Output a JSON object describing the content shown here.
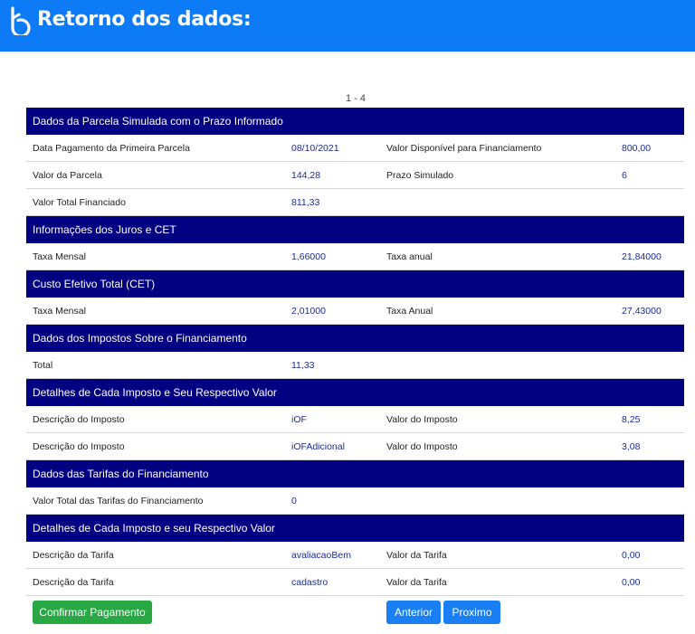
{
  "header": {
    "title": "Retorno dos dados:",
    "background_color": "#0d7bf5",
    "logo_icon": "brand-b-logo-icon"
  },
  "pager": {
    "text": "1 - 4"
  },
  "colors": {
    "section_header_bg": "#000080",
    "value_text": "#1a2a9a",
    "confirm_button": "#28a745",
    "nav_button": "#1a7ef5"
  },
  "sections": [
    {
      "title": "Dados da Parcela Simulada com o Prazo Informado",
      "rows": [
        {
          "l1": "Data Pagamento da Primeira Parcela",
          "v1": "08/10/2021",
          "l2": "Valor Disponível para Financiamento",
          "v2": "800,00"
        },
        {
          "l1": "Valor da Parcela",
          "v1": "144,28",
          "l2": "Prazo Simulado",
          "v2": "6"
        },
        {
          "l1": "Valor Total Financiado",
          "v1": "811,33",
          "l2": "",
          "v2": ""
        }
      ]
    },
    {
      "title": "Informações dos Juros e CET",
      "rows": [
        {
          "l1": "Taxa Mensal",
          "v1": "1,66000",
          "l2": "Taxa anual",
          "v2": "21,84000"
        }
      ]
    },
    {
      "title": "Custo Efetivo Total (CET)",
      "rows": [
        {
          "l1": "Taxa Mensal",
          "v1": "2,01000",
          "l2": "Taxa Anual",
          "v2": "27,43000"
        }
      ]
    },
    {
      "title": "Dados dos Impostos Sobre o Financiamento",
      "rows": [
        {
          "l1": "Total",
          "v1": "11,33",
          "l2": "",
          "v2": ""
        }
      ]
    },
    {
      "title": "Detalhes de Cada Imposto e Seu Respectivo Valor",
      "rows": [
        {
          "l1": "Descrição do Imposto",
          "v1": "iOF",
          "l2": "Valor do Imposto",
          "v2": "8,25"
        },
        {
          "l1": "Descrição do Imposto",
          "v1": "iOFAdicional",
          "l2": "Valor do Imposto",
          "v2": "3,08"
        }
      ]
    },
    {
      "title": "Dados das Tarifas do Financiamento",
      "rows": [
        {
          "l1": "Valor Total das Tarifas do Financiamento",
          "v1": "0",
          "l2": "",
          "v2": ""
        }
      ]
    },
    {
      "title": "Detalhes de Cada Imposto e seu Respectivo Valor",
      "rows": [
        {
          "l1": "Descrição da Tarifa",
          "v1": "avaliacaoBem",
          "l2": "Valor da Tarifa",
          "v2": "0,00"
        },
        {
          "l1": "Descrição da Tarifa",
          "v1": "cadastro",
          "l2": "Valor da Tarifa",
          "v2": "0,00"
        }
      ]
    }
  ],
  "buttons": {
    "confirm": "Confirmar Pagamento",
    "previous": "Anterior",
    "next": "Proximo"
  }
}
